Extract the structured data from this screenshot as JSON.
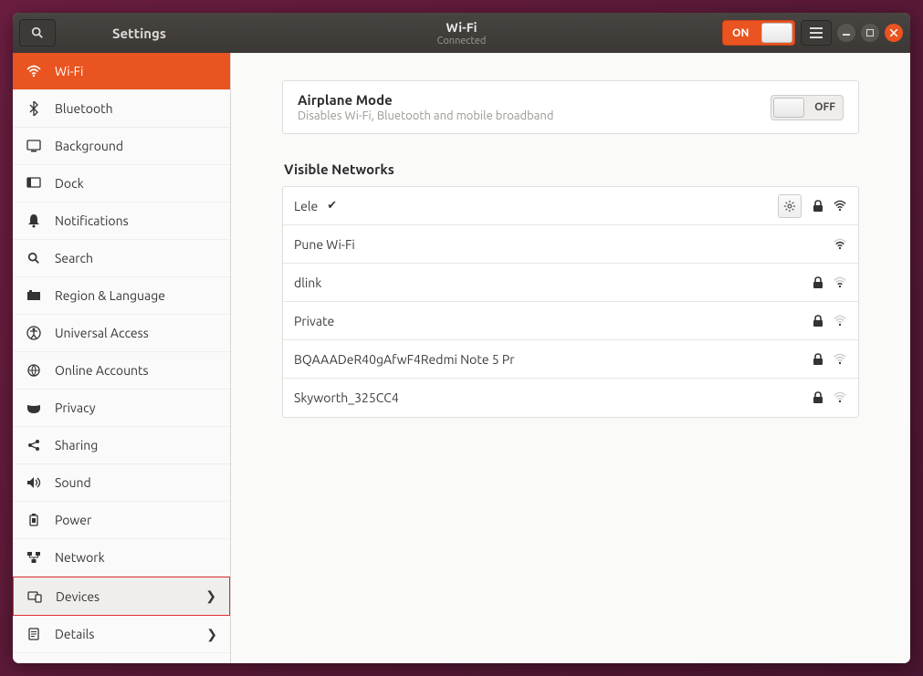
{
  "titlebar": {
    "app_title": "Settings",
    "page_title": "Wi-Fi",
    "page_subtitle": "Connected",
    "wifi_on_label": "ON"
  },
  "sidebar": {
    "items": [
      {
        "label": "Wi-Fi"
      },
      {
        "label": "Bluetooth"
      },
      {
        "label": "Background"
      },
      {
        "label": "Dock"
      },
      {
        "label": "Notifications"
      },
      {
        "label": "Search"
      },
      {
        "label": "Region & Language"
      },
      {
        "label": "Universal Access"
      },
      {
        "label": "Online Accounts"
      },
      {
        "label": "Privacy"
      },
      {
        "label": "Sharing"
      },
      {
        "label": "Sound"
      },
      {
        "label": "Power"
      },
      {
        "label": "Network"
      },
      {
        "label": "Devices"
      },
      {
        "label": "Details"
      }
    ]
  },
  "airplane": {
    "title": "Airplane Mode",
    "subtitle": "Disables Wi-Fi, Bluetooth and mobile broadband",
    "off_label": "OFF"
  },
  "section_title": "Visible Networks",
  "networks": [
    {
      "name": "Lele",
      "connected": true,
      "secured": true,
      "strength": 4,
      "has_settings": true
    },
    {
      "name": "Pune Wi-Fi",
      "connected": false,
      "secured": false,
      "strength": 3,
      "has_settings": false
    },
    {
      "name": "dlink",
      "connected": false,
      "secured": true,
      "strength": 2,
      "has_settings": false
    },
    {
      "name": "Private",
      "connected": false,
      "secured": true,
      "strength": 1,
      "has_settings": false
    },
    {
      "name": "BQAAADeR40gAfwF4Redmi Note 5 Pr",
      "connected": false,
      "secured": true,
      "strength": 1,
      "has_settings": false
    },
    {
      "name": "Skyworth_325CC4",
      "connected": false,
      "secured": true,
      "strength": 1,
      "has_settings": false
    }
  ]
}
